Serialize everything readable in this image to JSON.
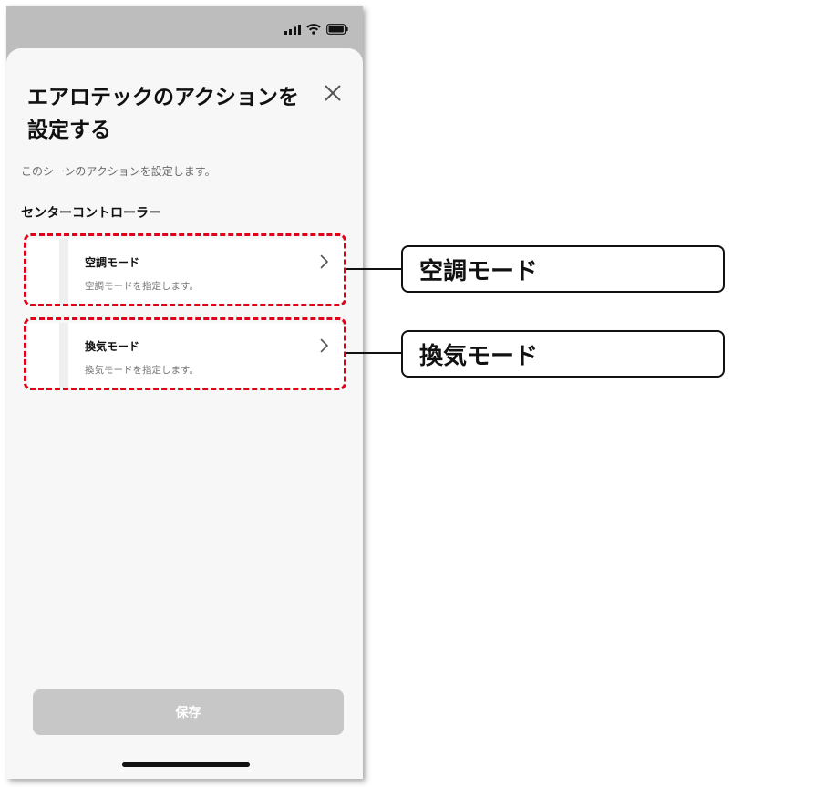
{
  "sheet": {
    "title": "エアロテックのアクションを設定する",
    "description": "このシーンのアクションを設定します。",
    "section_title": "センターコントローラー",
    "save_label": "保存"
  },
  "cards": [
    {
      "title": "空調モード",
      "subtitle": "空調モードを指定します。"
    },
    {
      "title": "換気モード",
      "subtitle": "換気モードを指定します。"
    }
  ],
  "callouts": [
    {
      "label": "空調モード"
    },
    {
      "label": "換気モード"
    }
  ],
  "icons": {
    "close": "close-icon",
    "chevron": "chevron-right-icon",
    "signal": "signal-icon",
    "wifi": "wifi-icon",
    "battery": "battery-icon"
  },
  "colors": {
    "highlight": "#e0001a",
    "save_disabled": "#c7c7c7"
  }
}
